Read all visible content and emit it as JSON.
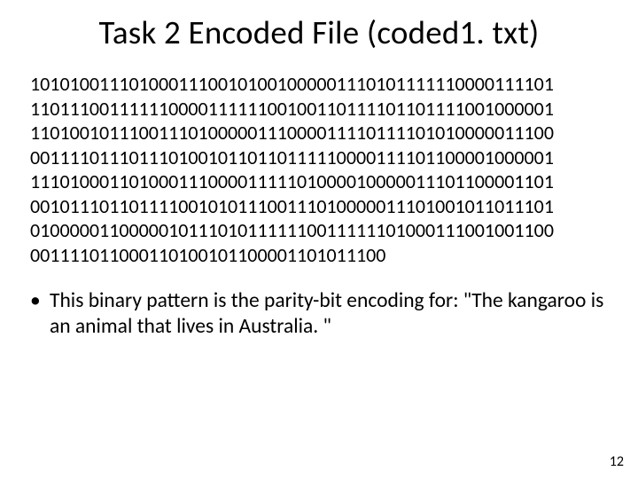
{
  "title": "Task 2 Encoded File (coded1. txt)",
  "binary_lines": [
    "10101001110100011100101001000001110101111110000111101",
    "11011100111111000011111100100110111101101111001000001",
    "11010010111001110100000111000011110111101010000011100",
    "00111101110111010010110110111110000111101100001000001",
    "11101000110100011100001111101000010000011101100001101",
    "00101110110111100101011100111010000011101001011011101",
    "01000001100000101110101111110011111101000111001001100",
    "001111011000110100101100001101011100"
  ],
  "bullet_text": "This binary pattern is the parity-bit encoding for: \"The kangaroo is an animal that lives in Australia. \"",
  "page_number": "12"
}
